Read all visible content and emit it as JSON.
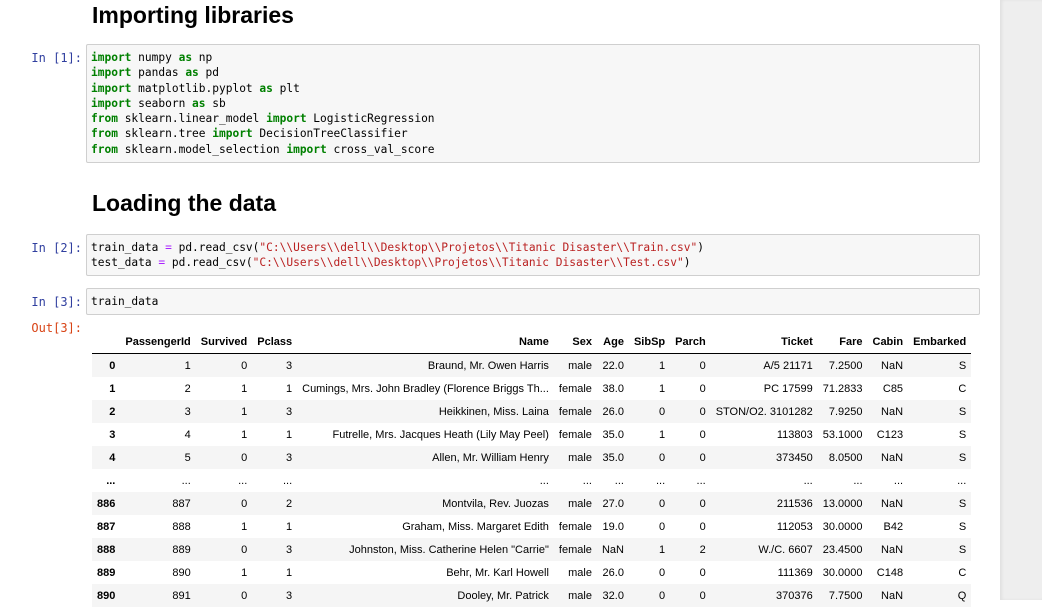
{
  "headings": {
    "importing": "Importing libraries",
    "loading": "Loading the data"
  },
  "prompts": {
    "in1": "In [1]:",
    "in2": "In [2]:",
    "in3": "In [3]:",
    "out3": "Out[3]:"
  },
  "cells": {
    "cell1": [
      [
        [
          "kw",
          "import"
        ],
        [
          "t",
          " numpy "
        ],
        [
          "kw",
          "as"
        ],
        [
          "t",
          " np"
        ]
      ],
      [
        [
          "kw",
          "import"
        ],
        [
          "t",
          " pandas "
        ],
        [
          "kw",
          "as"
        ],
        [
          "t",
          " pd"
        ]
      ],
      [
        [
          "kw",
          "import"
        ],
        [
          "t",
          " matplotlib.pyplot "
        ],
        [
          "kw",
          "as"
        ],
        [
          "t",
          " plt"
        ]
      ],
      [
        [
          "kw",
          "import"
        ],
        [
          "t",
          " seaborn "
        ],
        [
          "kw",
          "as"
        ],
        [
          "t",
          " sb"
        ]
      ],
      [
        [
          "kw",
          "from"
        ],
        [
          "t",
          " sklearn.linear_model "
        ],
        [
          "kw",
          "import"
        ],
        [
          "t",
          " LogisticRegression"
        ]
      ],
      [
        [
          "kw",
          "from"
        ],
        [
          "t",
          " sklearn.tree "
        ],
        [
          "kw",
          "import"
        ],
        [
          "t",
          " DecisionTreeClassifier"
        ]
      ],
      [
        [
          "kw",
          "from"
        ],
        [
          "t",
          " sklearn.model_selection "
        ],
        [
          "kw",
          "import"
        ],
        [
          "t",
          " cross_val_score"
        ]
      ]
    ],
    "cell2": [
      [
        [
          "t",
          "train_data "
        ],
        [
          "op",
          "="
        ],
        [
          "t",
          " pd.read_csv("
        ],
        [
          "str",
          "\"C:\\\\Users\\\\dell\\\\Desktop\\\\Projetos\\\\Titanic Disaster\\\\Train.csv\""
        ],
        [
          "t",
          ")"
        ]
      ],
      [
        [
          "t",
          "test_data "
        ],
        [
          "op",
          "="
        ],
        [
          "t",
          " pd.read_csv("
        ],
        [
          "str",
          "\"C:\\\\Users\\\\dell\\\\Desktop\\\\Projetos\\\\Titanic Disaster\\\\Test.csv\""
        ],
        [
          "t",
          ")"
        ]
      ]
    ],
    "cell3": [
      [
        [
          "t",
          "train_data"
        ]
      ]
    ]
  },
  "dataframe": {
    "columns": [
      "",
      "PassengerId",
      "Survived",
      "Pclass",
      "Name",
      "Sex",
      "Age",
      "SibSp",
      "Parch",
      "Ticket",
      "Fare",
      "Cabin",
      "Embarked"
    ],
    "rows": [
      [
        "0",
        "1",
        "0",
        "3",
        "Braund, Mr. Owen Harris",
        "male",
        "22.0",
        "1",
        "0",
        "A/5 21171",
        "7.2500",
        "NaN",
        "S"
      ],
      [
        "1",
        "2",
        "1",
        "1",
        "Cumings, Mrs. John Bradley (Florence Briggs Th...",
        "female",
        "38.0",
        "1",
        "0",
        "PC 17599",
        "71.2833",
        "C85",
        "C"
      ],
      [
        "2",
        "3",
        "1",
        "3",
        "Heikkinen, Miss. Laina",
        "female",
        "26.0",
        "0",
        "0",
        "STON/O2. 3101282",
        "7.9250",
        "NaN",
        "S"
      ],
      [
        "3",
        "4",
        "1",
        "1",
        "Futrelle, Mrs. Jacques Heath (Lily May Peel)",
        "female",
        "35.0",
        "1",
        "0",
        "113803",
        "53.1000",
        "C123",
        "S"
      ],
      [
        "4",
        "5",
        "0",
        "3",
        "Allen, Mr. William Henry",
        "male",
        "35.0",
        "0",
        "0",
        "373450",
        "8.0500",
        "NaN",
        "S"
      ],
      [
        "...",
        "...",
        "...",
        "...",
        "...",
        "...",
        "...",
        "...",
        "...",
        "...",
        "...",
        "...",
        "..."
      ],
      [
        "886",
        "887",
        "0",
        "2",
        "Montvila, Rev. Juozas",
        "male",
        "27.0",
        "0",
        "0",
        "211536",
        "13.0000",
        "NaN",
        "S"
      ],
      [
        "887",
        "888",
        "1",
        "1",
        "Graham, Miss. Margaret Edith",
        "female",
        "19.0",
        "0",
        "0",
        "112053",
        "30.0000",
        "B42",
        "S"
      ],
      [
        "888",
        "889",
        "0",
        "3",
        "Johnston, Miss. Catherine Helen \"Carrie\"",
        "female",
        "NaN",
        "1",
        "2",
        "W./C. 6607",
        "23.4500",
        "NaN",
        "S"
      ],
      [
        "889",
        "890",
        "1",
        "1",
        "Behr, Mr. Karl Howell",
        "male",
        "26.0",
        "0",
        "0",
        "111369",
        "30.0000",
        "C148",
        "C"
      ],
      [
        "890",
        "891",
        "0",
        "3",
        "Dooley, Mr. Patrick",
        "male",
        "32.0",
        "0",
        "0",
        "370376",
        "7.7500",
        "NaN",
        "Q"
      ]
    ]
  }
}
